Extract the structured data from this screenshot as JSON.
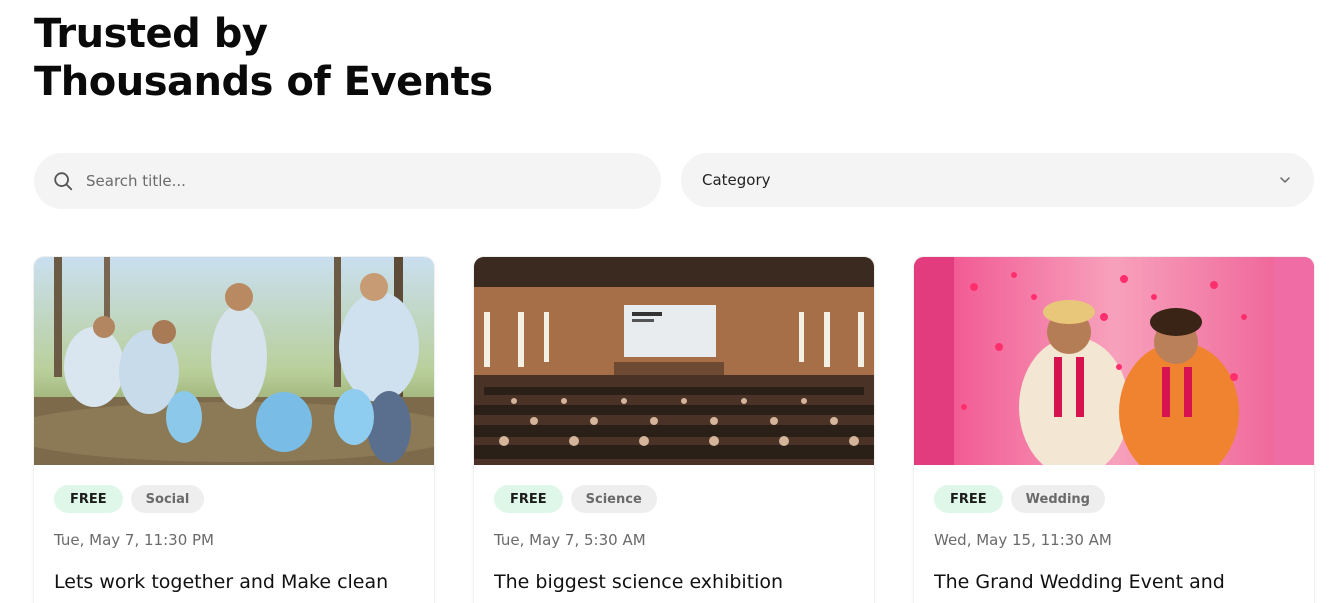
{
  "header": {
    "title_line1": "Trusted by",
    "title_line2": "Thousands of Events"
  },
  "search": {
    "placeholder": "Search title...",
    "value": ""
  },
  "filter": {
    "category_label": "Category"
  },
  "events": [
    {
      "price": "FREE",
      "category": "Social",
      "date": "Tue, May 7, 11:30 PM",
      "title": "Lets work together and Make clean"
    },
    {
      "price": "FREE",
      "category": "Science",
      "date": "Tue, May 7, 5:30 AM",
      "title": "The biggest science exhibition"
    },
    {
      "price": "FREE",
      "category": "Wedding",
      "date": "Wed, May 15, 11:30 AM",
      "title": "The Grand Wedding Event and"
    }
  ],
  "colors": {
    "free_badge_bg": "#dff7e9",
    "category_badge_bg": "#eeeeee",
    "input_bg": "#f4f4f4"
  }
}
